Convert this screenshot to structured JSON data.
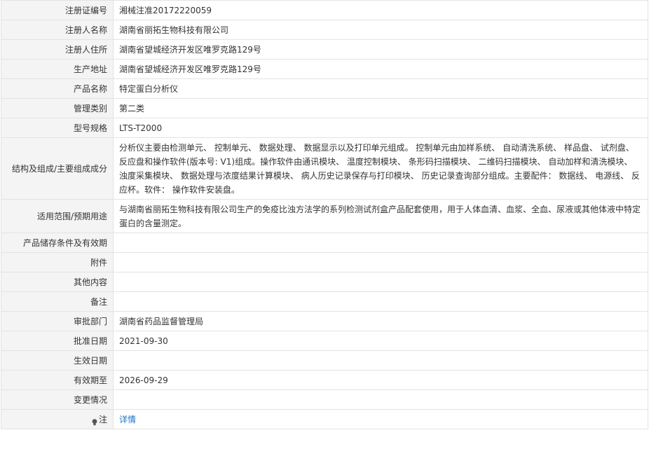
{
  "rows": [
    {
      "label": "注册证编号",
      "value": "湘械注准20172220059"
    },
    {
      "label": "注册人名称",
      "value": "湖南省丽拓生物科技有限公司"
    },
    {
      "label": "注册人住所",
      "value": "湖南省望城经济开发区唯罗克路129号"
    },
    {
      "label": "生产地址",
      "value": "湖南省望城经济开发区唯罗克路129号"
    },
    {
      "label": "产品名称",
      "value": "特定蛋白分析仪"
    },
    {
      "label": "管理类别",
      "value": "第二类"
    },
    {
      "label": "型号规格",
      "value": "LTS-T2000"
    },
    {
      "label": "结构及组成/主要组成成分",
      "value": "分析仪主要由检测单元、 控制单元、 数据处理、 数据显示以及打印单元组成。 控制单元由加样系统、 自动清洗系统、 样品盘、 试剂盘、 反应盘和操作软件(版本号: V1)组成。操作软件由通讯模块、 温度控制模块、 条形码扫描模块、 二维码扫描模块、 自动加样和清洗模块、 浊度采集模块、 数据处理与浓度结果计算模块、 病人历史记录保存与打印模块、 历史记录查询部分组成。主要配件： 数据线、 电源线、 反应杯。软件： 操作软件安装盘。"
    },
    {
      "label": "适用范围/预期用途",
      "value": "与湖南省丽拓生物科技有限公司生产的免疫比浊方法学的系列检测试剂盒产品配套使用，用于人体血清、血浆、全血、尿液或其他体液中特定蛋白的含量测定。"
    },
    {
      "label": "产品储存条件及有效期",
      "value": ""
    },
    {
      "label": "附件",
      "value": ""
    },
    {
      "label": "其他内容",
      "value": ""
    },
    {
      "label": "备注",
      "value": ""
    },
    {
      "label": "审批部门",
      "value": "湖南省药品监督管理局"
    },
    {
      "label": "批准日期",
      "value": "2021-09-30"
    },
    {
      "label": "生效日期",
      "value": ""
    },
    {
      "label": "有效期至",
      "value": "2026-09-29"
    },
    {
      "label": "变更情况",
      "value": ""
    }
  ],
  "note": {
    "label": "注",
    "icon": "bulb-icon",
    "link_text": "详情",
    "link_color": "#1a73c8"
  }
}
